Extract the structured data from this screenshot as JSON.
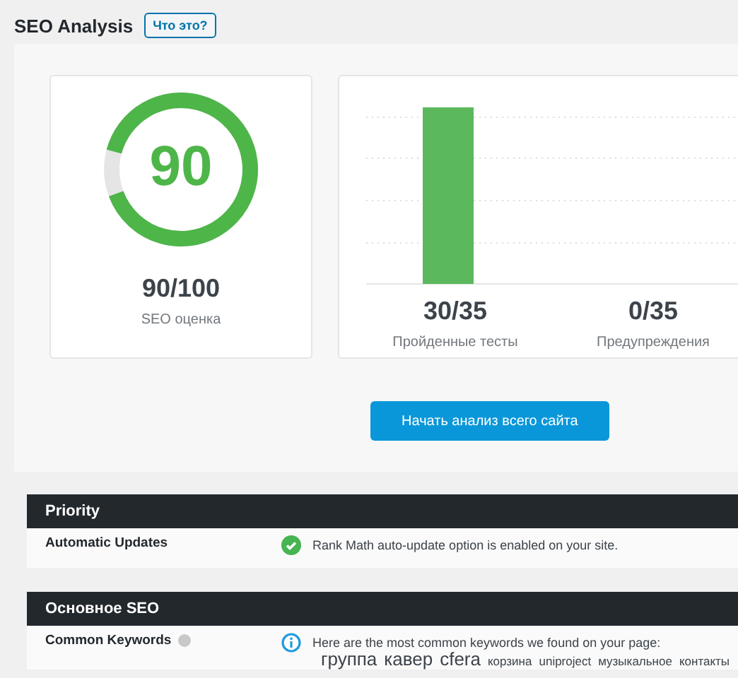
{
  "page_title": "SEO Analysis",
  "help_button": "Что это?",
  "score": {
    "value": "90",
    "total": "90/100",
    "label": "SEO оценка"
  },
  "stats": [
    {
      "value": "30/35",
      "label": "Пройденные тесты"
    },
    {
      "value": "0/35",
      "label": "Предупреждения"
    }
  ],
  "start_button": "Начать анализ всего сайта",
  "sections": [
    {
      "title": "Priority",
      "rows": [
        {
          "name": "Automatic Updates",
          "help": false,
          "kind": "pass",
          "text": "Rank Math auto-update option is enabled on your site."
        }
      ]
    },
    {
      "title": "Основное SEO",
      "rows": [
        {
          "name": "Common Keywords",
          "help": true,
          "kind": "info",
          "text": "Here are the most common keywords we found on your page:",
          "keywords": [
            {
              "text": "группа",
              "kind": "large"
            },
            {
              "text": "кавер",
              "kind": "large"
            },
            {
              "text": "cfera",
              "kind": "large"
            },
            {
              "text": "корзина",
              "kind": "small"
            },
            {
              "text": "uniproject",
              "kind": "small"
            },
            {
              "text": "музыкальное",
              "kind": "small"
            },
            {
              "text": "контакты",
              "kind": "small"
            }
          ]
        }
      ]
    }
  ]
}
